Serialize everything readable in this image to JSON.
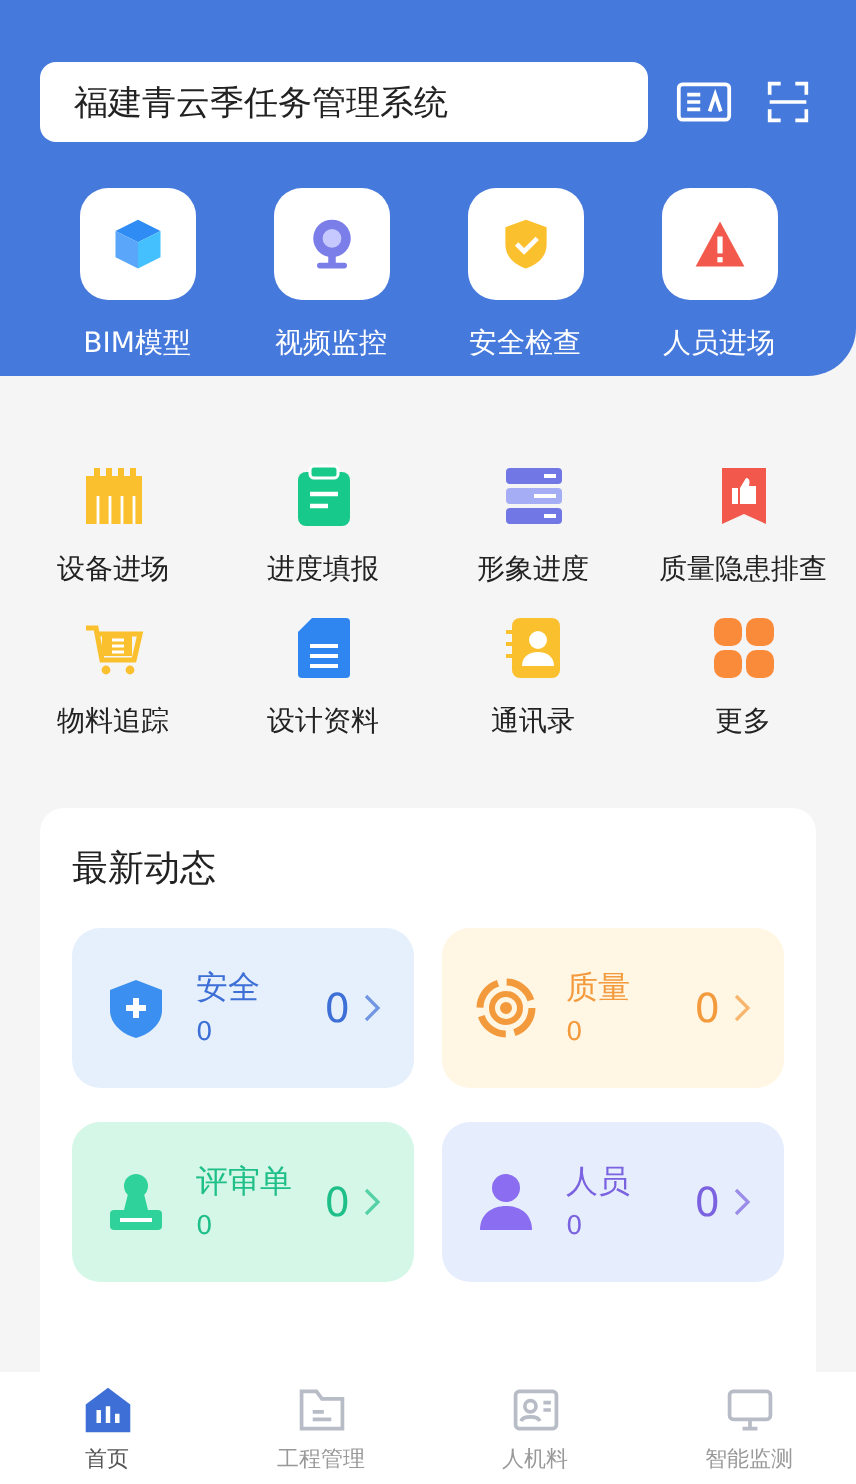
{
  "search": {
    "value": "福建青云季任务管理系统"
  },
  "quick": [
    {
      "label": "BIM模型",
      "kind": "cube"
    },
    {
      "label": "视频监控",
      "kind": "webcam"
    },
    {
      "label": "安全检查",
      "kind": "shield"
    },
    {
      "label": "人员进场",
      "kind": "warning"
    }
  ],
  "apps": [
    {
      "label": "设备进场",
      "kind": "piano"
    },
    {
      "label": "进度填报",
      "kind": "clipboard"
    },
    {
      "label": "形象进度",
      "kind": "stack"
    },
    {
      "label": "质量隐患排查",
      "kind": "thumb"
    },
    {
      "label": "物料追踪",
      "kind": "cart"
    },
    {
      "label": "设计资料",
      "kind": "doc"
    },
    {
      "label": "通讯录",
      "kind": "contacts"
    },
    {
      "label": "更多",
      "kind": "grid"
    }
  ],
  "news": {
    "title": "最新动态",
    "items": [
      {
        "label": "安全",
        "count": "0",
        "total": "0",
        "kind": "shield",
        "color": "#3d6fd6"
      },
      {
        "label": "质量",
        "count": "0",
        "total": "0",
        "kind": "target",
        "color": "#f39a3c"
      },
      {
        "label": "评审单",
        "count": "0",
        "total": "0",
        "kind": "stamp",
        "color": "#1fbf8a"
      },
      {
        "label": "人员",
        "count": "0",
        "total": "0",
        "kind": "person",
        "color": "#7a62e0"
      }
    ]
  },
  "tabs": [
    {
      "label": "首页",
      "kind": "home",
      "selected": true
    },
    {
      "label": "工程管理",
      "kind": "folder",
      "selected": false
    },
    {
      "label": "人机料",
      "kind": "id",
      "selected": false
    },
    {
      "label": "智能监测",
      "kind": "monitor",
      "selected": false
    }
  ]
}
